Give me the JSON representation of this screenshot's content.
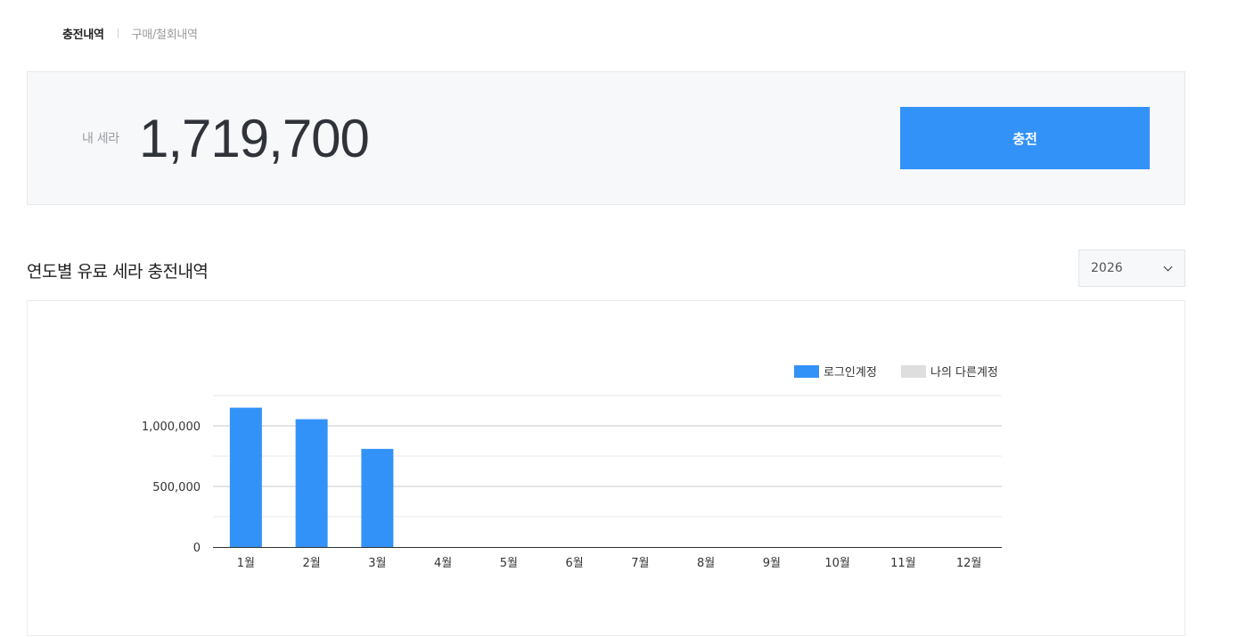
{
  "tabs": {
    "active": "충전내역",
    "inactive": "구매/철회내역"
  },
  "balance": {
    "label": "내 세라",
    "value": "1,719,700",
    "charge_button": "충전"
  },
  "section": {
    "title": "연도별 유료 세라 충전내역"
  },
  "year_select": {
    "value": "2026"
  },
  "colors": {
    "accent": "#3392f8",
    "secondary_series": "#dedede"
  },
  "chart_data": {
    "type": "bar",
    "categories": [
      "1월",
      "2월",
      "3월",
      "4월",
      "5월",
      "6월",
      "7월",
      "8월",
      "9월",
      "10월",
      "11월",
      "12월"
    ],
    "series": [
      {
        "name": "로그인계정",
        "color": "#3392f8",
        "values": [
          1150000,
          1055000,
          810000,
          0,
          0,
          0,
          0,
          0,
          0,
          0,
          0,
          0
        ]
      },
      {
        "name": "나의 다른계정",
        "color": "#dedede",
        "values": [
          0,
          0,
          0,
          0,
          0,
          0,
          0,
          0,
          0,
          0,
          0,
          0
        ]
      }
    ],
    "yticks": [
      0,
      500000,
      1000000
    ],
    "ytick_labels": [
      "0",
      "500,000",
      "1,000,000"
    ],
    "ylim": [
      0,
      1250000
    ],
    "grid": true,
    "legend_position": "top-right"
  }
}
